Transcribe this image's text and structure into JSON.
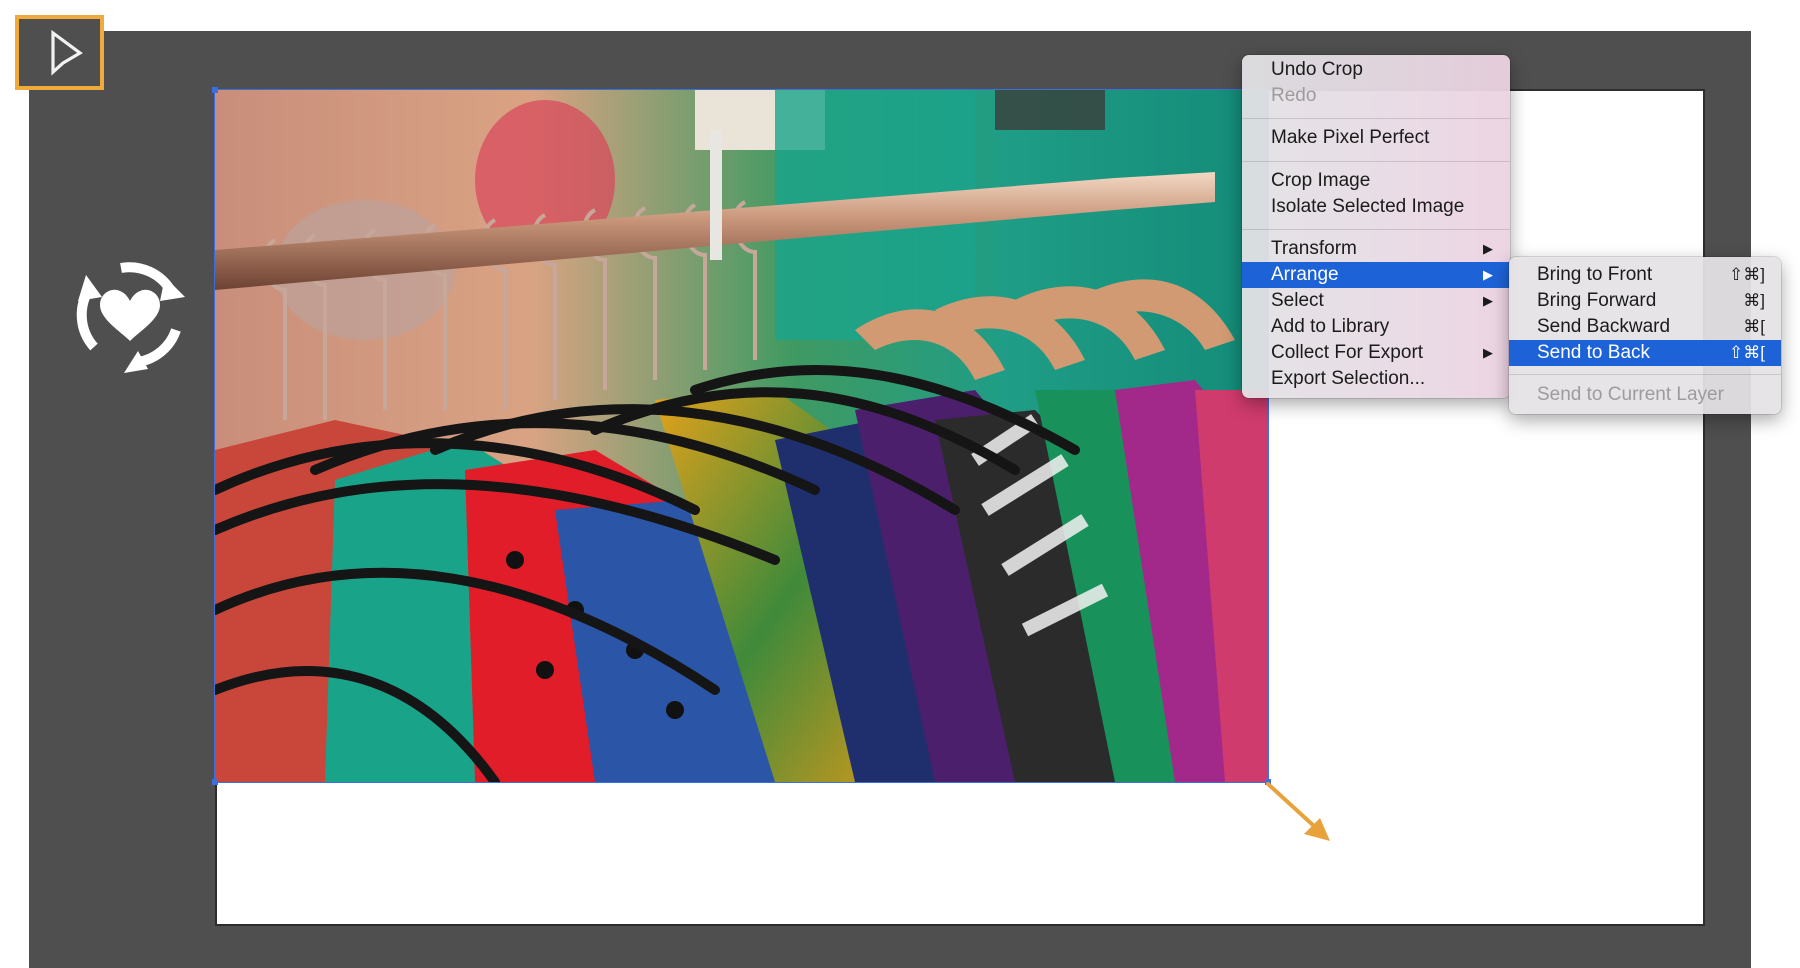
{
  "toolbar": {
    "selection_tool_icon": "pointer-arrow-icon",
    "highlight_color": "#f0a93b"
  },
  "side_icon": {
    "name": "sync-heart-icon"
  },
  "canvas": {
    "workspace_color": "#4f4f4f",
    "artboard_color": "#ffffff",
    "selection_color": "#3b6fe0",
    "image_subject": "clothes-rack-photo",
    "resize_arrow_color": "#e8a23c"
  },
  "context_menu": {
    "items": [
      {
        "label": "Undo Crop",
        "enabled": true
      },
      {
        "label": "Redo",
        "enabled": false
      },
      {
        "label": "Make Pixel Perfect",
        "enabled": true
      },
      {
        "label": "Crop Image",
        "enabled": true
      },
      {
        "label": "Isolate Selected Image",
        "enabled": true
      },
      {
        "label": "Transform",
        "enabled": true,
        "submenu_arrow": "▶"
      },
      {
        "label": "Arrange",
        "enabled": true,
        "submenu_arrow": "▶",
        "highlighted": true
      },
      {
        "label": "Select",
        "enabled": true,
        "submenu_arrow": "▶"
      },
      {
        "label": "Add to Library",
        "enabled": true
      },
      {
        "label": "Collect For Export",
        "enabled": true,
        "submenu_arrow": "▶"
      },
      {
        "label": "Export Selection...",
        "enabled": true
      }
    ]
  },
  "arrange_submenu": {
    "items": [
      {
        "label": "Bring to Front",
        "shortcut": "⇧⌘]"
      },
      {
        "label": "Bring Forward",
        "shortcut": "⌘]"
      },
      {
        "label": "Send Backward",
        "shortcut": "⌘["
      },
      {
        "label": "Send to Back",
        "shortcut": "⇧⌘[",
        "highlighted": true
      },
      {
        "label": "Send to Current Layer",
        "enabled": false
      }
    ],
    "highlight_color": "#1d63d7"
  }
}
